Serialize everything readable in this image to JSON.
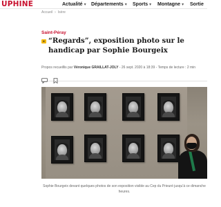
{
  "header": {
    "logo_text": "UPHINE",
    "nav": [
      {
        "label": "Actualité",
        "icon": "chevron-down-icon"
      },
      {
        "label": "Départements",
        "icon": "chevron-down-icon"
      },
      {
        "label": "Sports",
        "icon": "chevron-down-icon"
      },
      {
        "label": "Montagne",
        "icon": "chevron-down-icon"
      },
      {
        "label": "Sortie"
      }
    ]
  },
  "breadcrumb": {
    "items": [
      "Accueil",
      "Isère"
    ],
    "separator": "›"
  },
  "article": {
    "category": "Saint-Péray",
    "badge_icon": "premium-badge-icon",
    "title": "“Regards”, exposition photo sur le handicap par Sophie Bourgeix",
    "byline_prefix": "Propos recueillis par ",
    "author": "Véronique GRAILLAT-JOLY",
    "date": " - 26 sept. 2020 à 18:39 - Temps de lecture : 2 min",
    "share_icons": [
      "comment-icon",
      "bookmark-icon"
    ],
    "caption": "Sophie Bourgeix devant quelques photos de son exposition visible au Cep du Prieuré jusqu’à ce dimanche heures."
  },
  "colors": {
    "brand": "#c8102e",
    "badge": "#f2b705"
  }
}
